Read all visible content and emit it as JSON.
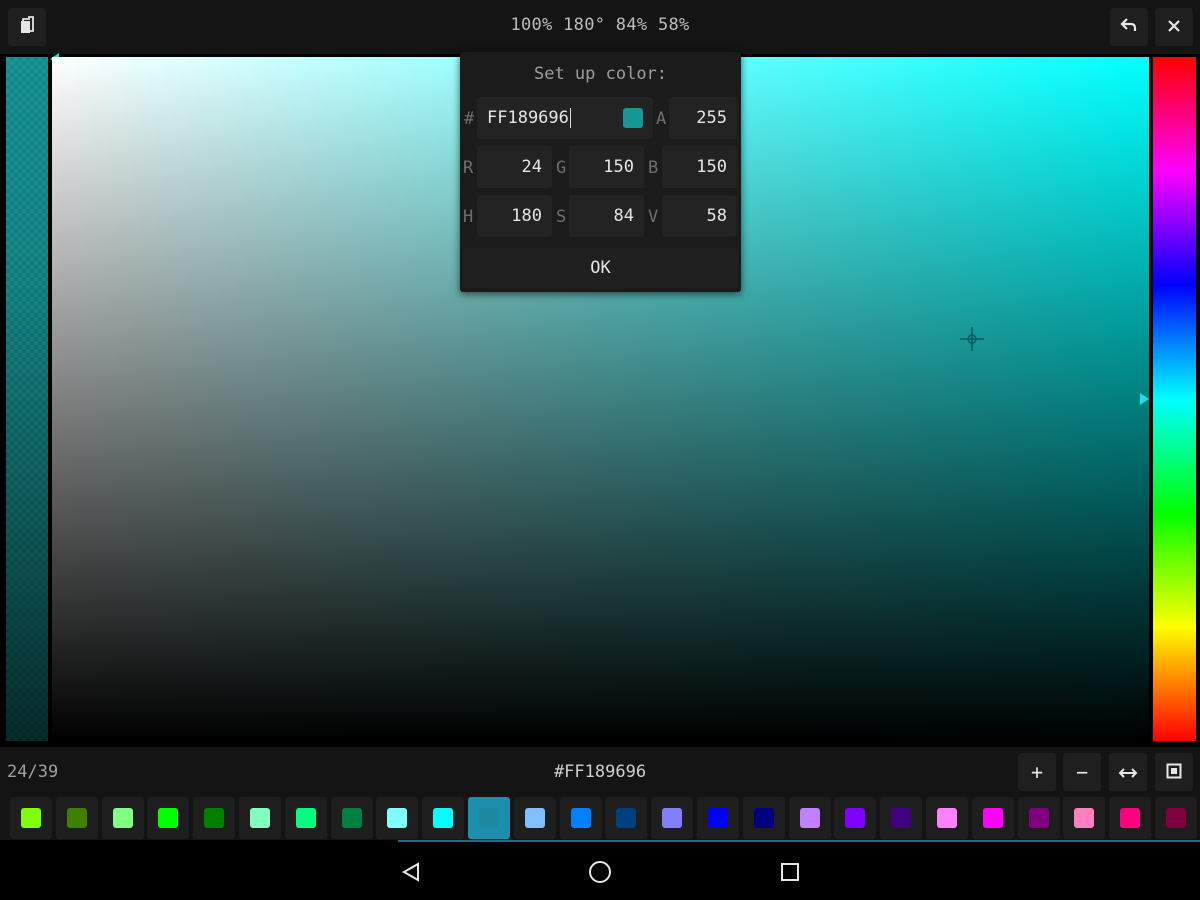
{
  "header": {
    "title": "100% 180° 84% 58%",
    "left_icon": "copy-icon",
    "undo_icon": "undo-icon",
    "close_icon": "close-icon"
  },
  "dialog": {
    "title": "Set up color:",
    "hex_label": "#",
    "hex_value": "FF189696",
    "a_label": "A",
    "a_value": "255",
    "r_label": "R",
    "r_value": "24",
    "g_label": "G",
    "g_value": "150",
    "b_label": "B",
    "b_value": "150",
    "h_label": "H",
    "h_value": "180",
    "s_label": "S",
    "s_value": "84",
    "v_label": "V",
    "v_value": "58",
    "ok_label": "OK",
    "preview_color": "#189696"
  },
  "picker": {
    "current_color": "#189696",
    "hue_degrees": 180,
    "saturation_percent": 84,
    "value_percent": 58
  },
  "bottom_bar": {
    "counter": "24/39",
    "hex": "#FF189696",
    "add_label": "+",
    "remove_label": "−",
    "swap_icon": "swap-arrows-icon",
    "fullscreen_icon": "square-icon"
  },
  "palette": {
    "selected_index": 10,
    "colors": [
      "#80ff00",
      "#408000",
      "#80ff80",
      "#00ff00",
      "#008000",
      "#80ffc0",
      "#00ff80",
      "#008040",
      "#80ffff",
      "#00ffff",
      "#189696",
      "#80c0ff",
      "#0080ff",
      "#004080",
      "#8080ff",
      "#0000ff",
      "#000080",
      "#c080ff",
      "#8000ff",
      "#400080",
      "#ff80ff",
      "#ff00ff",
      "#800080",
      "#ff80c0",
      "#ff0080",
      "#800040"
    ]
  },
  "navbar": {
    "back_icon": "back-triangle-icon",
    "home_icon": "home-circle-icon",
    "recents_icon": "recents-square-icon"
  }
}
